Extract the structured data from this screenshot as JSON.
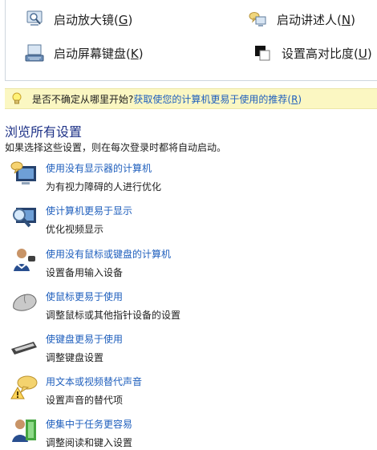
{
  "quick_actions": [
    {
      "icon": "magnifier-icon",
      "label": "启动放大镜(",
      "key": "G",
      "suffix": ")"
    },
    {
      "icon": "narrator-icon",
      "label": "启动讲述人(",
      "key": "N",
      "suffix": ")"
    },
    {
      "icon": "keyboard-screen-icon",
      "label": "启动屏幕键盘(",
      "key": "K",
      "suffix": ")"
    },
    {
      "icon": "high-contrast-icon",
      "label": "设置高对比度(",
      "key": "U",
      "suffix": ")"
    }
  ],
  "tip": {
    "icon": "lightbulb-icon",
    "text": "是否不确定从哪里开始?",
    "link_text": "获取使您的计算机更易于使用的推荐(",
    "link_key": "R",
    "link_suffix": ")"
  },
  "section": {
    "title": "浏览所有设置",
    "description": "如果选择这些设置，则在每次登录时都将自动启动。"
  },
  "settings": [
    {
      "icon": "monitor-speech-icon",
      "link": "使用没有显示器的计算机",
      "desc": "为有视力障碍的人进行优化"
    },
    {
      "icon": "monitor-magnify-icon",
      "link": "使计算机更易于显示",
      "desc": "优化视频显示"
    },
    {
      "icon": "person-input-icon",
      "link": "使用没有鼠标或键盘的计算机",
      "desc": "设置备用输入设备"
    },
    {
      "icon": "mouse-icon",
      "link": "使鼠标更易于使用",
      "desc": "调整鼠标或其他指针设备的设置"
    },
    {
      "icon": "keyboard-icon",
      "link": "使键盘更易于使用",
      "desc": "调整键盘设置"
    },
    {
      "icon": "speech-warning-icon",
      "link": "用文本或视频替代声音",
      "desc": "设置声音的替代项"
    },
    {
      "icon": "person-task-icon",
      "link": "使集中于任务更容易",
      "desc": "调整阅读和键入设置"
    }
  ]
}
